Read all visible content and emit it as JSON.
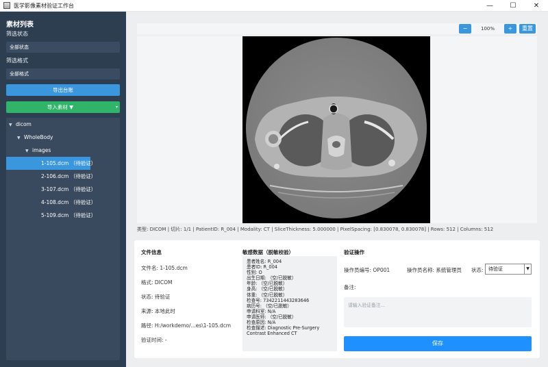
{
  "window": {
    "title": "医学影像素材验证工作台",
    "controls": [
      "—",
      "☐",
      "✕"
    ]
  },
  "sidebar": {
    "title": "素材列表",
    "status_filter_label": "筛选状态",
    "status_filter_value": "全部状态",
    "format_filter_label": "筛选格式",
    "format_filter_value": "全部格式",
    "export_button": "导出台账",
    "import_button": "导入素材 ▼",
    "import_caret": "▾",
    "tree": [
      {
        "label": "dicom",
        "arrow": "▼"
      },
      {
        "label": "WholeBody",
        "arrow": "▼"
      },
      {
        "label": "images",
        "arrow": "▼"
      },
      {
        "label": "1-105.dcm （待验证）",
        "selected": true
      },
      {
        "label": "2-106.dcm （待验证）"
      },
      {
        "label": "3-107.dcm （待验证）"
      },
      {
        "label": "4-108.dcm （待验证）"
      },
      {
        "label": "5-109.dcm （待验证）"
      }
    ]
  },
  "toolbar": {
    "zoom_out": "−",
    "zoom_level": "100%",
    "zoom_in": "+",
    "reset": "重置"
  },
  "image_meta": "类型: DICOM | 切片: 1/1 | PatientID: R_004 | Modality: CT | SliceThickness: 5.000000 | PixelSpacing: [0.830078, 0.830078] | Rows: 512 | Columns: 512",
  "file_info": {
    "title": "文件信息",
    "name": "文件名: 1-105.dcm",
    "format": "格式: DICOM",
    "status": "状态: 待验证",
    "source": "来源: 本地此时",
    "path": "路径: H:/workdemo/...es\\1-105.dcm",
    "verify_time": "验证时间: -"
  },
  "sensitive": {
    "title": "敏感数据（脱敏校验）",
    "lines": [
      "患者姓名: R_004",
      "患者ID: R_004",
      "性别: O",
      "出生日期: （空/已脱敏）",
      "年龄: （空/已脱敏）",
      "身高: （空/已脱敏）",
      "体重: （空/已脱敏）",
      "检查号: 7342211443283646",
      "病历号: （空/已脱敏）",
      "申请科室: N/A",
      "申请医师: （空/已脱敏）",
      "检查原因: N/A",
      "检查描述: Diagnostic Pre-Surgery",
      "Contrast Enhanced CT"
    ]
  },
  "verify": {
    "title": "验证操作",
    "operator_id": "操作员编号: OP001",
    "operator_name": "操作员名称: 系统管理员",
    "status_label": "状态:",
    "status_value": "待验证",
    "note_label": "备注:",
    "note_placeholder": "请输入验证备注...",
    "save_button": "保存"
  }
}
